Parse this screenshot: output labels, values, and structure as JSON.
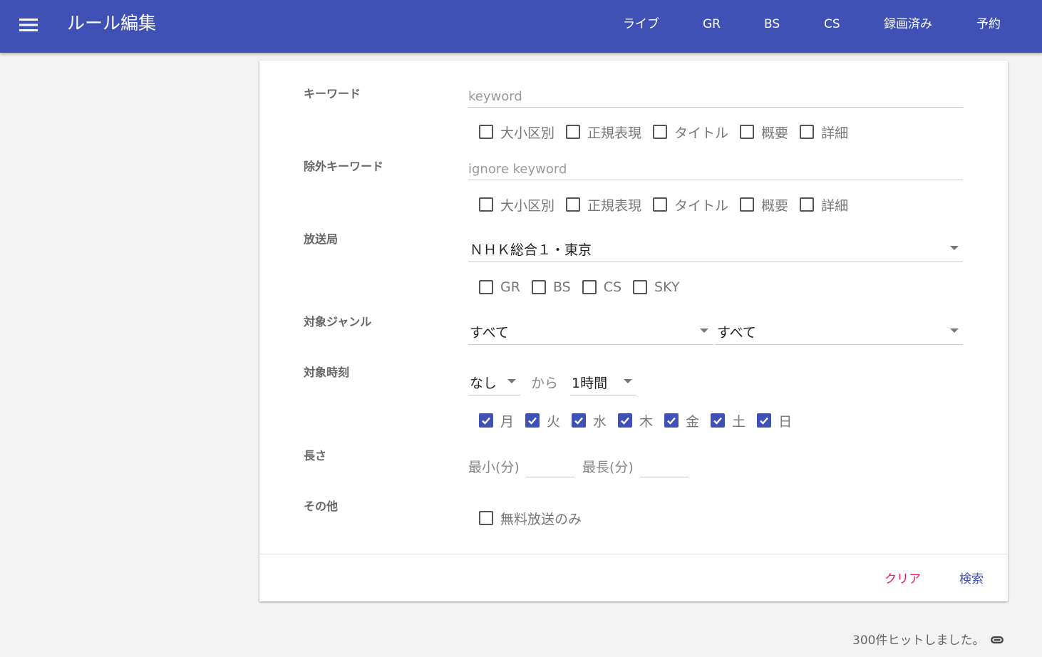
{
  "appbar": {
    "title": "ルール編集",
    "nav": [
      "ライブ",
      "GR",
      "BS",
      "CS",
      "録画済み",
      "予約"
    ]
  },
  "form": {
    "keyword": {
      "label": "キーワード",
      "placeholder": "keyword",
      "options": [
        {
          "label": "大小区別",
          "checked": false
        },
        {
          "label": "正規表現",
          "checked": false
        },
        {
          "label": "タイトル",
          "checked": false
        },
        {
          "label": "概要",
          "checked": false
        },
        {
          "label": "詳細",
          "checked": false
        }
      ]
    },
    "ignore_keyword": {
      "label": "除外キーワード",
      "placeholder": "ignore keyword",
      "options": [
        {
          "label": "大小区別",
          "checked": false
        },
        {
          "label": "正規表現",
          "checked": false
        },
        {
          "label": "タイトル",
          "checked": false
        },
        {
          "label": "概要",
          "checked": false
        },
        {
          "label": "詳細",
          "checked": false
        }
      ]
    },
    "station": {
      "label": "放送局",
      "selected": "ＮＨＫ総合１・東京",
      "types": [
        {
          "label": "GR",
          "checked": false
        },
        {
          "label": "BS",
          "checked": false
        },
        {
          "label": "CS",
          "checked": false
        },
        {
          "label": "SKY",
          "checked": false
        }
      ]
    },
    "genre": {
      "label": "対象ジャンル",
      "genre1": "すべて",
      "genre2": "すべて"
    },
    "time": {
      "label": "対象時刻",
      "start": "なし",
      "from_text": "から",
      "range": "1時間",
      "days": [
        {
          "label": "月",
          "checked": true
        },
        {
          "label": "火",
          "checked": true
        },
        {
          "label": "水",
          "checked": true
        },
        {
          "label": "木",
          "checked": true
        },
        {
          "label": "金",
          "checked": true
        },
        {
          "label": "土",
          "checked": true
        },
        {
          "label": "日",
          "checked": true
        }
      ]
    },
    "duration": {
      "label": "長さ",
      "min_label": "最小(分)",
      "max_label": "最長(分)"
    },
    "other": {
      "label": "その他",
      "free_only": {
        "label": "無料放送のみ",
        "checked": false
      }
    }
  },
  "actions": {
    "clear": "クリア",
    "search": "検索"
  },
  "footer": {
    "hits": "300件ヒットしました。"
  },
  "colors": {
    "primary": "#3f51b5",
    "clear": "#e91e63",
    "search": "#3f51b5"
  }
}
